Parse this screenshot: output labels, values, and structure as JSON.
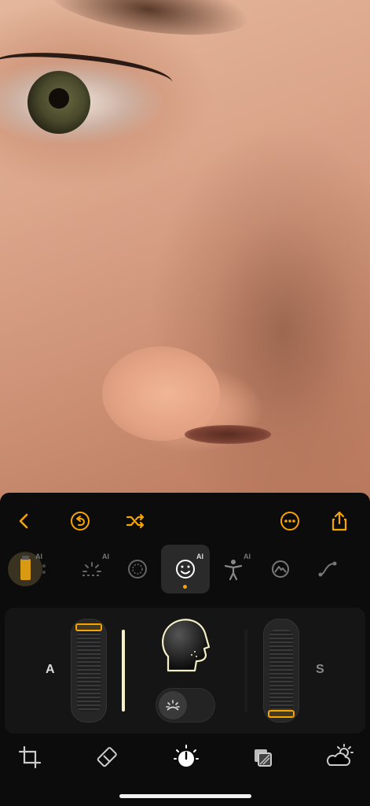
{
  "colors": {
    "accent": "#f5a400",
    "panel": "#0c0c0c",
    "cream": "#f5f0c8"
  },
  "photo": {
    "description_visible": ""
  },
  "toolbar": {
    "back_icon": "chevron-left-icon",
    "undo_icon": "undo-circle-icon",
    "shuffle_icon": "shuffle-icon",
    "more_icon": "more-circle-icon",
    "share_icon": "share-icon"
  },
  "tools": [
    {
      "icon": "film-icon",
      "ai": "AI"
    },
    {
      "icon": "sparkle-light-icon",
      "ai": "AI"
    },
    {
      "icon": "dotted-circle-icon",
      "ai": ""
    },
    {
      "icon": "face-icon",
      "ai": "AI",
      "active": true
    },
    {
      "icon": "body-icon",
      "ai": "AI"
    },
    {
      "icon": "mountain-icon",
      "ai": ""
    },
    {
      "icon": "curve-icon",
      "ai": ""
    }
  ],
  "controls": {
    "left_label": "A",
    "right_label": "S",
    "left_slider_level": 1.0,
    "right_slider_level": 0.0
  },
  "bottombar": [
    "crop-icon",
    "eraser-icon",
    "adjust-dial-icon",
    "layers-icon",
    "weather-icon"
  ]
}
